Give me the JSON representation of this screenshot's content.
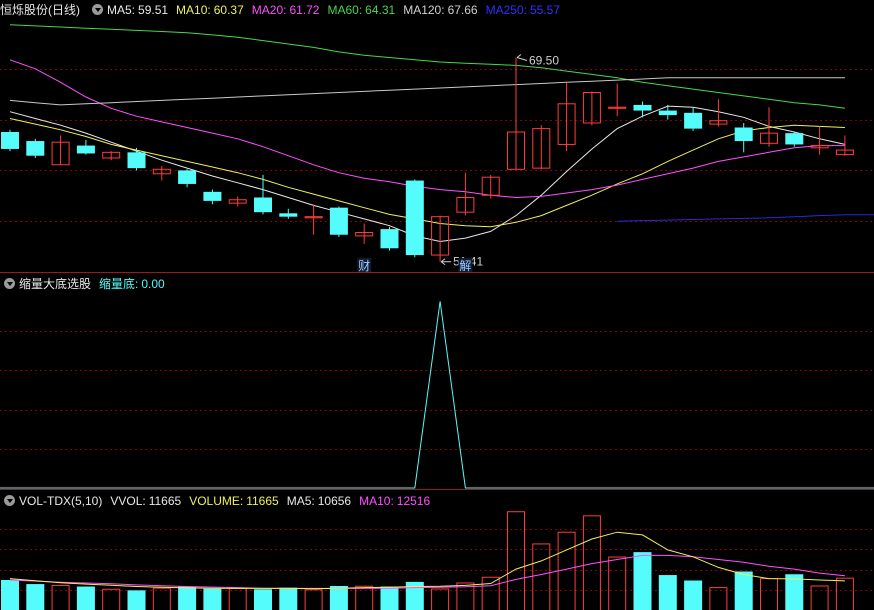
{
  "stock": {
    "title": "恒烁股份(日线)"
  },
  "colors": {
    "up": "#ff3c3c",
    "down": "#54fcfc",
    "grid": "#8b0000",
    "frame": "#9b1b1b",
    "ma5": "#e8e8e8",
    "ma10": "#f0f058",
    "ma20": "#ff50ff",
    "ma60": "#48d848",
    "ma120": "#c8c8c8",
    "ma250": "#2828e0"
  },
  "price_panel": {
    "legend": [
      {
        "label": "MA5:",
        "value": "59.51",
        "color": "#e8e8e8"
      },
      {
        "label": "MA10:",
        "value": "60.37",
        "color": "#f0f058"
      },
      {
        "label": "MA20:",
        "value": "61.72",
        "color": "#ff50ff"
      },
      {
        "label": "MA60:",
        "value": "64.31",
        "color": "#48d848"
      },
      {
        "label": "MA120:",
        "value": "67.66",
        "color": "#d0d0d0"
      },
      {
        "label": "MA250:",
        "value": "55.57",
        "color": "#3030ff"
      }
    ],
    "high_label": "69.50",
    "low_label": "51.41",
    "markers": [
      {
        "text": "财",
        "index": 14
      },
      {
        "text": "解",
        "index": 18
      }
    ]
  },
  "indicator_panel": {
    "title": "缩量大底选股",
    "legend": [
      {
        "label": "缩量底:",
        "value": "0.00",
        "color": "#54fcfc"
      }
    ]
  },
  "volume_panel": {
    "title": "VOL-TDX(5,10)",
    "legend": [
      {
        "label": "VVOL:",
        "value": "11665",
        "color": "#e8e8e8"
      },
      {
        "label": "VOLUME:",
        "value": "11665",
        "color": "#f0f058"
      },
      {
        "label": "MA5:",
        "value": "10656",
        "color": "#e8e8e8"
      },
      {
        "label": "MA10:",
        "value": "12516",
        "color": "#ff50ff"
      }
    ]
  },
  "chart_data": [
    {
      "type": "candlestick",
      "ylim": [
        50.5,
        73
      ],
      "series": [
        {
          "open": 62.9,
          "close": 61.4,
          "high": 63.1,
          "low": 61.2
        },
        {
          "open": 62.1,
          "close": 60.8,
          "high": 62.3,
          "low": 60.6
        },
        {
          "open": 60.0,
          "close": 62.0,
          "high": 62.6,
          "low": 60.0
        },
        {
          "open": 61.7,
          "close": 61.0,
          "high": 62.2,
          "low": 60.9
        },
        {
          "open": 60.6,
          "close": 61.1,
          "high": 61.2,
          "low": 60.4
        },
        {
          "open": 61.1,
          "close": 59.7,
          "high": 61.5,
          "low": 59.5
        },
        {
          "open": 59.2,
          "close": 59.6,
          "high": 59.9,
          "low": 58.6
        },
        {
          "open": 59.5,
          "close": 58.3,
          "high": 59.6,
          "low": 58.0
        },
        {
          "open": 57.6,
          "close": 56.8,
          "high": 57.8,
          "low": 56.5
        },
        {
          "open": 56.6,
          "close": 56.9,
          "high": 57.2,
          "low": 56.3
        },
        {
          "open": 57.1,
          "close": 55.8,
          "high": 59.1,
          "low": 55.6
        },
        {
          "open": 55.7,
          "close": 55.4,
          "high": 56.1,
          "low": 55.2
        },
        {
          "open": 55.3,
          "close": 55.4,
          "high": 56.5,
          "low": 53.8
        },
        {
          "open": 56.2,
          "close": 53.8,
          "high": 56.3,
          "low": 53.6
        },
        {
          "open": 53.7,
          "close": 54.0,
          "high": 54.8,
          "low": 53.0
        },
        {
          "open": 54.3,
          "close": 52.6,
          "high": 54.5,
          "low": 52.4
        },
        {
          "open": 58.6,
          "close": 52.0,
          "high": 58.7,
          "low": 51.8
        },
        {
          "open": 52.0,
          "close": 55.4,
          "high": 55.5,
          "low": 51.41
        },
        {
          "open": 55.8,
          "close": 57.1,
          "high": 59.3,
          "low": 55.5
        },
        {
          "open": 57.3,
          "close": 58.9,
          "high": 59.1,
          "low": 57.0
        },
        {
          "open": 59.6,
          "close": 62.9,
          "high": 69.5,
          "low": 59.6
        },
        {
          "open": 59.7,
          "close": 63.2,
          "high": 63.5,
          "low": 59.6
        },
        {
          "open": 61.8,
          "close": 65.4,
          "high": 67.3,
          "low": 61.2
        },
        {
          "open": 63.7,
          "close": 66.4,
          "high": 66.5,
          "low": 63.5
        },
        {
          "open": 65.0,
          "close": 65.1,
          "high": 67.2,
          "low": 64.3
        },
        {
          "open": 65.3,
          "close": 64.8,
          "high": 65.6,
          "low": 64.2
        },
        {
          "open": 64.8,
          "close": 64.4,
          "high": 65.3,
          "low": 64.0
        },
        {
          "open": 64.6,
          "close": 63.2,
          "high": 65.1,
          "low": 63.0
        },
        {
          "open": 63.6,
          "close": 63.9,
          "high": 65.8,
          "low": 63.4
        },
        {
          "open": 63.3,
          "close": 62.1,
          "high": 63.7,
          "low": 61.1
        },
        {
          "open": 61.9,
          "close": 62.8,
          "high": 65.1,
          "low": 61.6
        },
        {
          "open": 62.8,
          "close": 61.8,
          "high": 62.9,
          "low": 61.6
        },
        {
          "open": 61.5,
          "close": 61.7,
          "high": 63.4,
          "low": 60.9
        },
        {
          "open": 60.9,
          "close": 61.3,
          "high": 62.6,
          "low": 60.8
        }
      ],
      "ma_lines": [
        {
          "name": "MA5",
          "values": [
            64.7,
            64.1,
            63.5,
            62.8,
            62.0,
            61.2,
            60.4,
            59.7,
            59.0,
            58.4,
            57.8,
            57.1,
            56.4,
            55.8,
            55.2,
            54.6,
            53.7,
            53.2,
            53.5,
            54.1,
            55.5,
            57.3,
            59.4,
            61.4,
            63.2,
            64.3,
            65.2,
            65.1,
            64.7,
            64.2,
            63.4,
            62.9,
            62.3,
            61.8
          ]
        },
        {
          "name": "MA10",
          "values": [
            64.1,
            63.6,
            63.1,
            62.5,
            61.8,
            61.3,
            60.8,
            60.3,
            59.8,
            59.3,
            58.7,
            58.0,
            57.4,
            56.8,
            56.2,
            55.6,
            55.2,
            54.8,
            54.6,
            54.5,
            54.9,
            55.5,
            56.4,
            57.3,
            58.3,
            59.2,
            60.3,
            61.3,
            62.3,
            63.0,
            63.3,
            63.5,
            63.4,
            63.3
          ]
        },
        {
          "name": "MA20",
          "values": [
            69.3,
            68.5,
            67.3,
            66.0,
            65.0,
            64.3,
            63.8,
            63.3,
            62.8,
            62.3,
            61.6,
            60.8,
            60.0,
            59.3,
            58.8,
            58.5,
            58.1,
            57.8,
            57.6,
            57.3,
            57.1,
            57.2,
            57.5,
            57.8,
            58.2,
            58.7,
            59.2,
            59.7,
            60.3,
            60.7,
            61.1,
            61.5,
            61.7,
            61.7
          ]
        },
        {
          "name": "MA60",
          "values": [
            72.4,
            72.3,
            72.2,
            72.1,
            72.0,
            71.9,
            71.8,
            71.7,
            71.5,
            71.3,
            71.0,
            70.7,
            70.4,
            70.0,
            69.7,
            69.5,
            69.3,
            69.1,
            69.0,
            68.9,
            68.8,
            68.6,
            68.3,
            68.0,
            67.7,
            67.3,
            67.0,
            66.7,
            66.4,
            66.1,
            65.8,
            65.5,
            65.3,
            65.0
          ]
        },
        {
          "name": "MA120",
          "values": [
            65.7,
            65.5,
            65.3,
            65.4,
            65.5,
            65.6,
            65.7,
            65.8,
            65.9,
            66.0,
            66.1,
            66.2,
            66.3,
            66.4,
            66.5,
            66.6,
            66.7,
            66.8,
            66.9,
            67.0,
            67.1,
            67.2,
            67.3,
            67.4,
            67.5,
            67.6,
            67.7,
            67.7,
            67.7,
            67.7,
            67.7,
            67.7,
            67.7,
            67.7
          ]
        },
        {
          "name": "MA250",
          "start": 24,
          "values": [
            null,
            null,
            null,
            null,
            null,
            null,
            null,
            null,
            null,
            null,
            null,
            null,
            null,
            null,
            null,
            null,
            null,
            null,
            null,
            null,
            null,
            null,
            null,
            null,
            55.0,
            55.05,
            55.1,
            55.15,
            55.2,
            55.25,
            55.3,
            55.4,
            55.5,
            55.57
          ]
        }
      ]
    },
    {
      "type": "line",
      "ylim": [
        0,
        1.05
      ],
      "values": [
        0,
        0,
        0,
        0,
        0,
        0,
        0,
        0,
        0,
        0,
        0,
        0,
        0,
        0,
        0,
        0,
        0,
        1,
        0,
        0,
        0,
        0,
        0,
        0,
        0,
        0,
        0,
        0,
        0,
        0,
        0,
        0,
        0,
        0
      ]
    },
    {
      "type": "bar",
      "ylim": [
        0,
        37000
      ],
      "values": [
        11000,
        9500,
        9000,
        8600,
        7600,
        7200,
        8000,
        8600,
        7800,
        7900,
        7600,
        8200,
        7400,
        8800,
        8700,
        8600,
        10300,
        7700,
        9900,
        12000,
        36000,
        24200,
        28500,
        34500,
        19400,
        21200,
        12800,
        10800,
        8200,
        14100,
        11500,
        13100,
        8800,
        11665
      ],
      "ma5": [
        11500,
        10700,
        10000,
        9500,
        9100,
        8600,
        8300,
        8100,
        8000,
        7900,
        7900,
        7900,
        7800,
        8000,
        8200,
        8300,
        8600,
        8700,
        9000,
        9700,
        15000,
        18000,
        22000,
        26000,
        28500,
        27500,
        22000,
        19500,
        15600,
        13000,
        11500,
        11400,
        11000,
        10656
      ],
      "ma10": [
        11000,
        10600,
        10200,
        9900,
        9600,
        9200,
        8900,
        8600,
        8400,
        8200,
        8000,
        7900,
        7900,
        7900,
        7900,
        8000,
        8200,
        8300,
        8500,
        8900,
        11200,
        13000,
        15000,
        17000,
        18500,
        20000,
        20000,
        19500,
        18500,
        17500,
        16000,
        15000,
        13500,
        12516
      ]
    }
  ]
}
